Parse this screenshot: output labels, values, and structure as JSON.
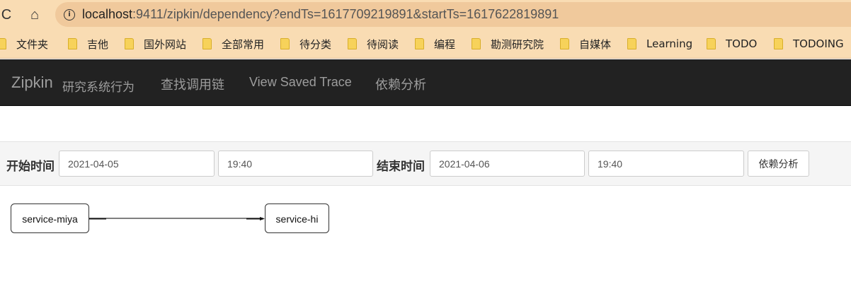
{
  "browser": {
    "reload_glyph": "C",
    "home_glyph": "⌂",
    "info_glyph": "i",
    "url_host": "localhost",
    "url_rest": ":9411/zipkin/dependency?endTs=1617709219891&startTs=1617622819891",
    "bookmarks": [
      "文件夹",
      "吉他",
      "国外网站",
      "全部常用",
      "待分类",
      "待阅读",
      "编程",
      "勘测研究院",
      "自媒体",
      "Learning",
      "TODO",
      "TODOING"
    ]
  },
  "navbar": {
    "brand": "Zipkin",
    "brand_sub": "研究系统行为",
    "links": [
      "查找调用链",
      "View Saved Trace",
      "依赖分析"
    ]
  },
  "form": {
    "start_label": "开始时间",
    "start_date": "2021-04-05",
    "start_time": "19:40",
    "end_label": "结束时间",
    "end_date": "2021-04-06",
    "end_time": "19:40",
    "submit_label": "依赖分析"
  },
  "graph": {
    "nodes": [
      "service-miya",
      "service-hi"
    ],
    "edges": [
      {
        "from": "service-miya",
        "to": "service-hi"
      }
    ]
  }
}
